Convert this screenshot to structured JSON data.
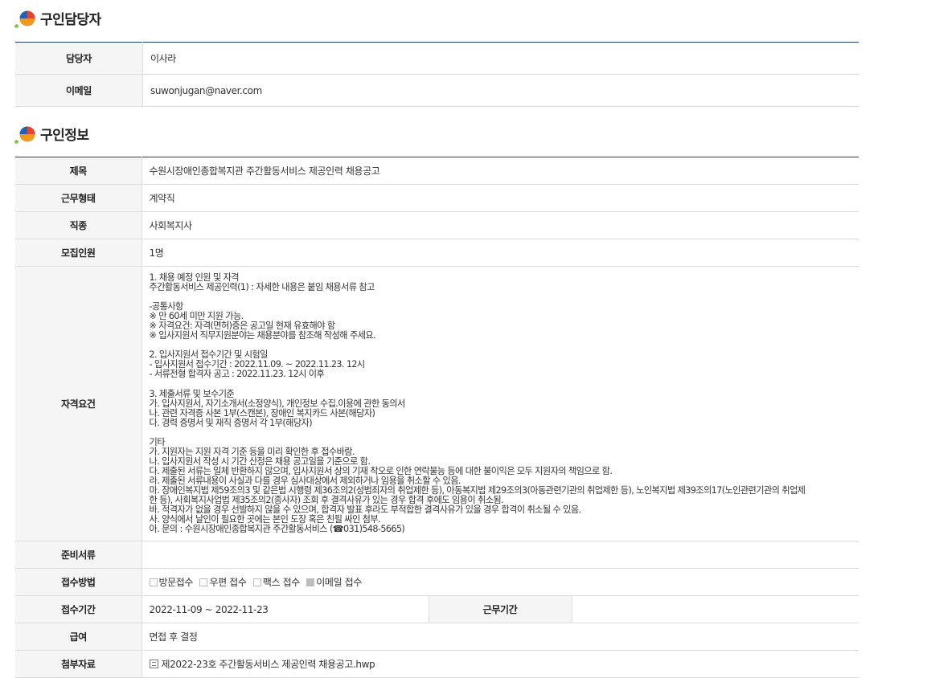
{
  "contact_section": {
    "title": "구인담당자",
    "rows": [
      {
        "label": "담당자",
        "value": "이사라"
      },
      {
        "label": "이메일",
        "value": "suwonjugan@naver.com"
      }
    ]
  },
  "job_section": {
    "title": "구인정보",
    "rows": {
      "title": {
        "label": "제목",
        "value": "수원시장애인종합복지관 주간활동서비스 제공인력 채용공고"
      },
      "employment_type": {
        "label": "근무형태",
        "value": "계약직"
      },
      "job_category": {
        "label": "직종",
        "value": "사회복지사"
      },
      "headcount": {
        "label": "모집인원",
        "value": "1명"
      },
      "requirements": {
        "label": "자격요건",
        "lines": [
          "1. 채용 예정 인원 및 자격",
          "주간활동서비스 제공인력(1) : 자세한 내용은 붙임 채용서류 참고",
          "",
          "-공통사항",
          "※ 만 60세 미만 지원 가능.",
          "※ 자격요건: 자격(면허)증은 공고일 현재 유효해야 함",
          "※ 입사지원서 직무지원분야는 채용분야를 참조해 작성해 주세요.",
          "",
          "2. 입사지원서 접수기간 및 시험일",
          "- 입사지원서 접수기간 : 2022.11.09. ~ 2022.11.23. 12시",
          "- 서류전형 합격자 공고 : 2022.11.23. 12시 이후",
          "",
          "3. 제출서류 및 보수기준",
          "가. 입사지원서, 자기소개서(소정양식), 개인정보 수집.이용에 관한 동의서",
          "나. 관련 자격증 사본 1부(스캔본), 장애인 복지카드 사본(해당자)",
          "다. 경력 증명서 및 재직 증명서 각 1부(해당자)",
          "",
          "기타",
          "가. 지원자는 지원 자격 기준 등을 미리 확인한 후 접수바람.",
          "나. 입사지원서 작성 시 기간 산정은 채용 공고일을 기준으로 함.",
          "다. 제출된 서류는 일체 반환하지 않으며, 입사지원서 상의 기재 착오로 인한 연락불능 등에 대한 불이익은 모두 지원자의 책임으로 함.",
          "라. 제출된 서류내용이 사실과 다를 경우 심사대상에서 제외하거나 임용을 취소할 수 있음.",
          "마. 장애인복지법 제59조의3 및 같은법 시행령 제36조의2(성범죄자의 취업제한 등), 아동복지법 제29조의3(아동관련기관의 취업제한 등), 노인복지법 제39조의17(노인관련기관의 취업제",
          "한 등), 사회복지사업법 제35조의2(종사자) 조회 후 결격사유가 있는 경우 합격 후에도 임용이 취소됨.",
          "바. 적격자가 없을 경우 선발하지 않을 수 있으며, 합격자 발표 후라도 부적합한 결격사유가 있을 경우 합격이 취소될 수 있음.",
          "사. 양식에서 날인이 필요한 곳에는 본인 도장 혹은 친필 싸인 첨부.",
          "아. 문의 : 수원시장애인종합복지관 주간활동서비스 (☎031)548-5665)"
        ]
      },
      "documents": {
        "label": "준비서류",
        "value": ""
      },
      "submission": {
        "label": "접수방법",
        "options": [
          {
            "label": "방문접수",
            "checked": false
          },
          {
            "label": "우편 접수",
            "checked": false
          },
          {
            "label": "팩스 접수",
            "checked": false
          },
          {
            "label": "이메일 접수",
            "checked": true
          }
        ]
      },
      "period": {
        "label": "접수기간",
        "value": "2022-11-09 ~ 2022-11-23",
        "work_label": "근무기간",
        "work_value": ""
      },
      "salary": {
        "label": "급여",
        "value": "면접 후 결정"
      },
      "attachment": {
        "label": "첨부자료",
        "icon": "file-icon",
        "value": "제2022-23호 주간활동서비스 제공인력 채용공고.hwp"
      }
    }
  },
  "colors": {
    "header_rule": "#1f3f73",
    "label_bg": "#f5f5f5",
    "border": "#dcdcdc"
  }
}
